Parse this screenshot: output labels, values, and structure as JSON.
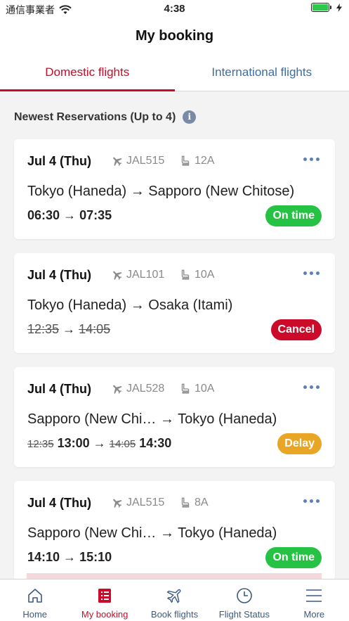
{
  "status_bar": {
    "carrier": "通信事業者",
    "time": "4:38"
  },
  "header": {
    "title": "My booking"
  },
  "tabs": [
    {
      "label": "Domestic flights",
      "active": true
    },
    {
      "label": "International flights",
      "active": false
    }
  ],
  "section": {
    "title": "Newest Reservations (Up to 4)",
    "info_icon": "info-icon"
  },
  "bookings": [
    {
      "date": "Jul 4 (Thu)",
      "flight": "JAL515",
      "seat": "12A",
      "route": "Tokyo (Haneda) → Sapporo (New Chitose)",
      "dep": "06:30",
      "arr": "07:35",
      "status": "On time",
      "status_color": "#26c244"
    },
    {
      "date": "Jul 4 (Thu)",
      "flight": "JAL101",
      "seat": "10A",
      "route": "Tokyo (Haneda) → Osaka (Itami)",
      "dep_old": "12:35",
      "arr_old": "14:05",
      "status": "Cancel",
      "status_color": "#cc0b2a"
    },
    {
      "date": "Jul 4 (Thu)",
      "flight": "JAL528",
      "seat": "10A",
      "route": "Sapporo (New Chi… → Tokyo (Haneda)",
      "dep_old": "12:35",
      "dep": "13:00",
      "arr_old": "14:05",
      "arr": "14:30",
      "status": "Delay",
      "status_color": "#e9a524"
    },
    {
      "date": "Jul 4 (Thu)",
      "flight": "JAL515",
      "seat": "8A",
      "route": "Sapporo (New Chi… → Tokyo (Haneda)",
      "dep": "14:10",
      "arr": "15:10",
      "status": "On time",
      "status_color": "#26c244"
    }
  ],
  "bottom_nav": [
    {
      "label": "Home",
      "icon": "home-icon",
      "active": false
    },
    {
      "label": "My booking",
      "icon": "booking-icon",
      "active": true
    },
    {
      "label": "Book flights",
      "icon": "plane-icon",
      "active": false
    },
    {
      "label": "Flight Status",
      "icon": "clock-icon",
      "active": false
    },
    {
      "label": "More",
      "icon": "menu-icon",
      "active": false
    }
  ],
  "colors": {
    "accent": "#cc0b2a",
    "link": "#3b6ea5"
  }
}
